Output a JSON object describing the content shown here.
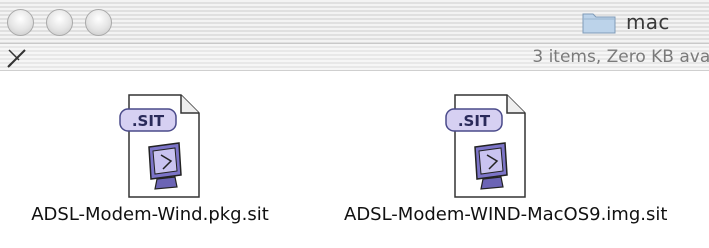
{
  "window": {
    "title": "mac",
    "status": "3 items, Zero KB avai"
  },
  "files": [
    {
      "name": "ADSL-Modem-Wind.pkg.sit",
      "badge": ".SIT",
      "icon": "stuffit-archive-icon"
    },
    {
      "name": "ADSL-Modem-WIND-MacOS9.img.sit",
      "badge": ".SIT",
      "icon": "stuffit-archive-icon"
    }
  ],
  "icons": {
    "traffic_lights": [
      "close-icon",
      "minimize-icon",
      "zoom-icon"
    ],
    "title": "folder-icon",
    "status": "pencil-icon"
  }
}
